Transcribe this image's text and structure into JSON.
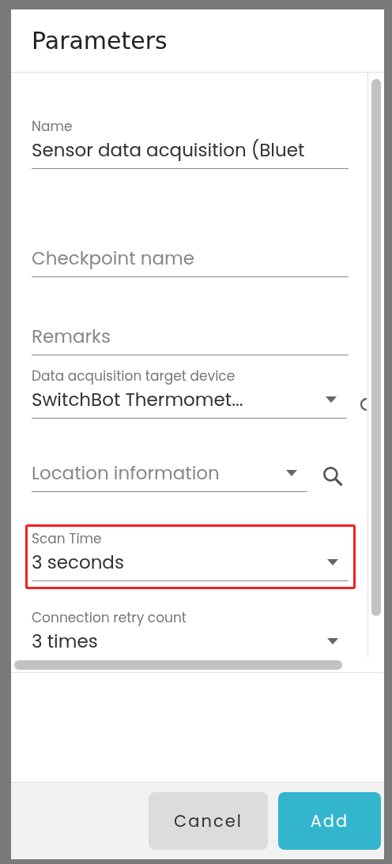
{
  "dialog": {
    "title": "Parameters",
    "fields": [
      {
        "kind": "text",
        "label": "Name",
        "value": "Sensor data acquisition (Bluet",
        "highlighted": false
      },
      {
        "kind": "text",
        "placeholder": "Checkpoint name",
        "highlighted": false
      },
      {
        "kind": "text",
        "placeholder": "Remarks",
        "highlighted": false
      },
      {
        "kind": "select",
        "label": "Data acquisition target device",
        "value": "SwitchBot Thermomet...",
        "highlighted": false
      },
      {
        "kind": "select-search",
        "placeholder": "Location information",
        "highlighted": false
      },
      {
        "kind": "select",
        "label": "Scan Time",
        "value": "3 seconds",
        "highlighted": true
      },
      {
        "kind": "select",
        "label": "Connection retry count",
        "value": "3 times",
        "highlighted": false
      }
    ],
    "buttons": [
      {
        "label": "Cancel",
        "kind": "secondary"
      },
      {
        "label": "Add",
        "kind": "primary"
      }
    ]
  }
}
